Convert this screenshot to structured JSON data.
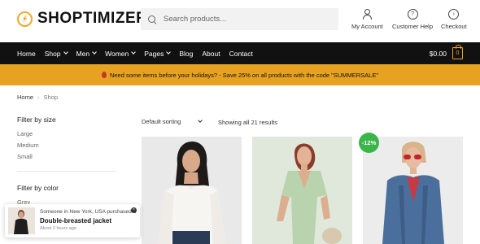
{
  "header": {
    "logo_text": "SHOPTIMIZER",
    "search_placeholder": "Search products...",
    "links": [
      {
        "label": "My Account",
        "icon": "user-icon"
      },
      {
        "label": "Customer Help",
        "icon": "help-icon"
      },
      {
        "label": "Checkout",
        "icon": "arrow-right-icon"
      }
    ]
  },
  "nav": {
    "items": [
      {
        "label": "Home"
      },
      {
        "label": "Shop"
      },
      {
        "label": "Men"
      },
      {
        "label": "Women"
      },
      {
        "label": "Pages"
      },
      {
        "label": "Blog"
      },
      {
        "label": "About"
      },
      {
        "label": "Contact"
      }
    ],
    "cart_total": "$0.00",
    "cart_count": "0"
  },
  "promo": {
    "text": "Need some items before your holidays? - Save 25% on all products with the code \"SUMMERSALE\"",
    "color": "#e8a221"
  },
  "breadcrumb": {
    "home": "Home",
    "current": "Shop"
  },
  "sidebar": {
    "size_title": "Filter by size",
    "sizes": [
      "Large",
      "Medium",
      "Small"
    ],
    "color_title": "Filter by color",
    "colors": [
      "Grey"
    ]
  },
  "toolbar": {
    "sorting": "Default sorting",
    "results": "Showing all 21 results"
  },
  "products": {
    "badge": "-12%"
  },
  "popup": {
    "line1": "Someone in New York, USA purchased a",
    "product": "Double-breasted jacket",
    "time": "About 2 hours ago"
  },
  "colors": {
    "accent": "#e8a221",
    "nav_bg": "#111111",
    "sale_badge": "#3bb54a"
  }
}
